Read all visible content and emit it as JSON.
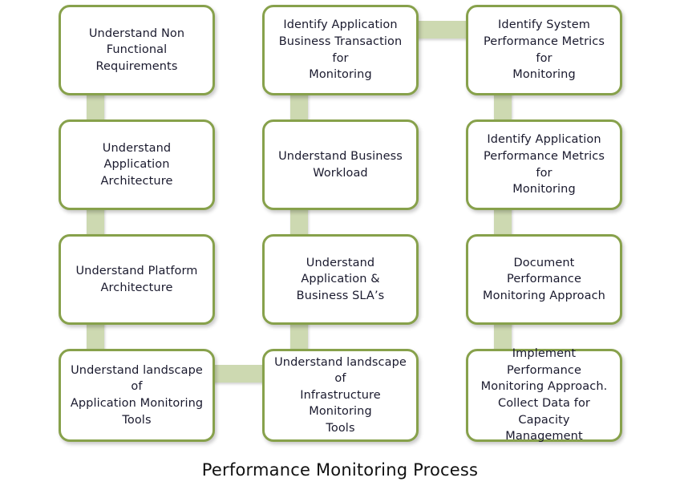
{
  "diagram": {
    "title": "Performance Monitoring Process",
    "colors": {
      "node_border": "#87a14b",
      "node_fill": "#ffffff",
      "connector": "#cdd9b1",
      "text": "#1a1a2e",
      "background": "#ffffff"
    },
    "nodes": [
      {
        "id": "understand-non-functional-requirements",
        "label": "Understand Non\nFunctional Requirements",
        "row": 1,
        "column": 1
      },
      {
        "id": "identify-application-business-transaction-for-monitoring",
        "label": "Identify Application\nBusiness Transaction for\nMonitoring",
        "row": 1,
        "column": 2
      },
      {
        "id": "identify-system-performance-metrics-for-monitoring",
        "label": "Identify System\nPerformance Metrics for\nMonitoring",
        "row": 1,
        "column": 3
      },
      {
        "id": "understand-application-architecture",
        "label": "Understand Application\nArchitecture",
        "row": 2,
        "column": 1
      },
      {
        "id": "understand-business-workload",
        "label": "Understand Business\nWorkload",
        "row": 2,
        "column": 2
      },
      {
        "id": "identify-application-performance-metrics-for-monitoring",
        "label": "Identify Application\nPerformance Metrics for\nMonitoring",
        "row": 2,
        "column": 3
      },
      {
        "id": "understand-platform-architecture",
        "label": "Understand Platform\nArchitecture",
        "row": 3,
        "column": 1
      },
      {
        "id": "understand-application-and-business-slas",
        "label": "Understand Application &\nBusiness SLA’s",
        "row": 3,
        "column": 2
      },
      {
        "id": "document-performance-monitoring-approach",
        "label": "Document Performance\nMonitoring  Approach",
        "row": 3,
        "column": 3
      },
      {
        "id": "understand-landscape-of-application-monitoring-tools",
        "label": "Understand landscape of\nApplication Monitoring\nTools",
        "row": 4,
        "column": 1
      },
      {
        "id": "understand-landscape-of-infrastructure-monitoring-tools",
        "label": "Understand landscape of\nInfrastructure Monitoring\nTools",
        "row": 4,
        "column": 2
      },
      {
        "id": "implement-performance-monitoring-approach-collect-data",
        "label": "Implement  Performance\nMonitoring  Approach.\nCollect Data for Capacity\nManagement",
        "row": 4,
        "column": 4
      }
    ],
    "connectors": [
      {
        "id": "col1-row1-to-row2",
        "orientation": "vertical"
      },
      {
        "id": "col1-row2-to-row3",
        "orientation": "vertical"
      },
      {
        "id": "col1-row3-to-row4",
        "orientation": "vertical"
      },
      {
        "id": "col2-row1-to-row2",
        "orientation": "vertical"
      },
      {
        "id": "col2-row2-to-row3",
        "orientation": "vertical"
      },
      {
        "id": "col2-row3-to-row4",
        "orientation": "vertical"
      },
      {
        "id": "col3-row1-to-row2",
        "orientation": "vertical"
      },
      {
        "id": "col3-row2-to-row3",
        "orientation": "vertical"
      },
      {
        "id": "col3-row3-to-row4",
        "orientation": "vertical"
      },
      {
        "id": "row1-col2-to-col3",
        "orientation": "horizontal"
      },
      {
        "id": "row4-col1-to-col2",
        "orientation": "horizontal"
      }
    ]
  }
}
